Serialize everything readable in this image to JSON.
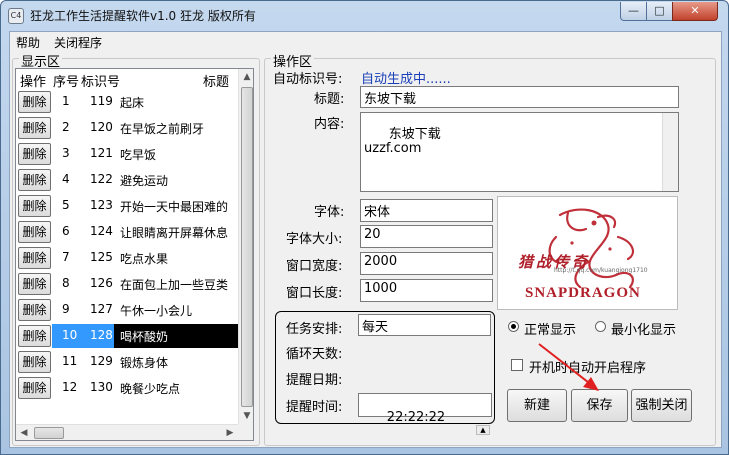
{
  "window": {
    "title": "狂龙工作生活提醒软件v1.0   狂龙 版权所有",
    "icon_text": "C4",
    "minimize_glyph": "—",
    "maximize_glyph": "□",
    "close_glyph": "✕"
  },
  "menu": {
    "items": [
      "帮助",
      "关闭程序"
    ]
  },
  "display_area": {
    "label": "显示区",
    "columns": [
      "操作",
      "序号",
      "标识号",
      "标题"
    ],
    "delete_label": "删除",
    "rows": [
      {
        "seq": "1",
        "id": "119",
        "title": "起床"
      },
      {
        "seq": "2",
        "id": "120",
        "title": "在早饭之前刷牙"
      },
      {
        "seq": "3",
        "id": "121",
        "title": "吃早饭"
      },
      {
        "seq": "4",
        "id": "122",
        "title": "避免运动"
      },
      {
        "seq": "5",
        "id": "123",
        "title": "开始一天中最困难的"
      },
      {
        "seq": "6",
        "id": "124",
        "title": "让眼睛离开屏幕休息"
      },
      {
        "seq": "7",
        "id": "125",
        "title": "吃点水果"
      },
      {
        "seq": "8",
        "id": "126",
        "title": "在面包上加一些豆类"
      },
      {
        "seq": "9",
        "id": "127",
        "title": "午休一小会儿"
      },
      {
        "seq": "10",
        "id": "128",
        "title": "喝杯酸奶"
      },
      {
        "seq": "11",
        "id": "129",
        "title": "锻炼身体"
      },
      {
        "seq": "12",
        "id": "130",
        "title": "晚餐少吃点"
      }
    ],
    "selected_row": 9,
    "scroll_up": "▲",
    "scroll_down": "▼",
    "scroll_left": "◀",
    "scroll_right": "▶"
  },
  "operation_area": {
    "label": "操作区",
    "auto_id_label": "自动标识号:",
    "auto_id_value": "自动生成中......",
    "title_label": "标题:",
    "title_value": "东坡下载",
    "content_label": "内容:",
    "content_value": "东坡下载\nuzzf.com",
    "font_label": "字体:",
    "font_value": "宋体",
    "font_size_label": "字体大小:",
    "font_size_value": "20",
    "window_width_label": "窗口宽度:",
    "window_width_value": "2000",
    "window_height_label": "窗口长度:",
    "window_height_value": "1000",
    "task_label": "任务安排:",
    "task_value": "每天",
    "cycle_label": "循环天数:",
    "date_label": "提醒日期:",
    "time_label": "提醒时间:",
    "time_value": "22:22:22",
    "radio_normal": "正常显示",
    "radio_minimize": "最小化显示",
    "autostart_label": "开机时自动开启程序",
    "btn_new": "新建",
    "btn_save": "保存",
    "btn_force_close": "强制关闭"
  },
  "preview": {
    "caption": "SNAPDRAGON",
    "script_text": "猎战传奇",
    "url_text": "http://t.qq.com/kuangiong1710"
  },
  "colors": {
    "accent_blue": "#3399ff",
    "selected_row": "#000000",
    "auto_id_text": "#1a3fb8",
    "annotation_arrow": "#e02020",
    "logo_red": "#c0303a"
  }
}
